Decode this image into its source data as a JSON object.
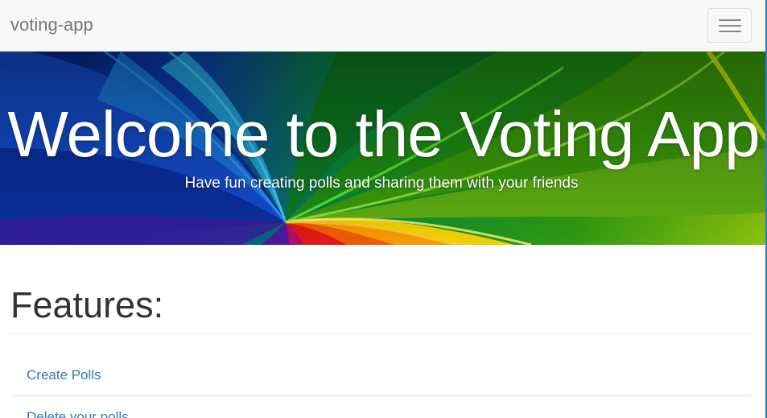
{
  "navbar": {
    "brand": "voting-app"
  },
  "hero": {
    "title": "Welcome to the Voting App",
    "subtitle": "Have fun creating polls and sharing them with your friends"
  },
  "features": {
    "heading": "Features:",
    "items": [
      {
        "label": "Create Polls"
      },
      {
        "label": "Delete your polls"
      }
    ]
  },
  "colors": {
    "link": "#337ab7",
    "navbar_bg": "#f8f8f8",
    "brand_text": "#777777",
    "heading_text": "#333333"
  },
  "icons": {
    "menu_toggle": "hamburger-menu-icon"
  }
}
